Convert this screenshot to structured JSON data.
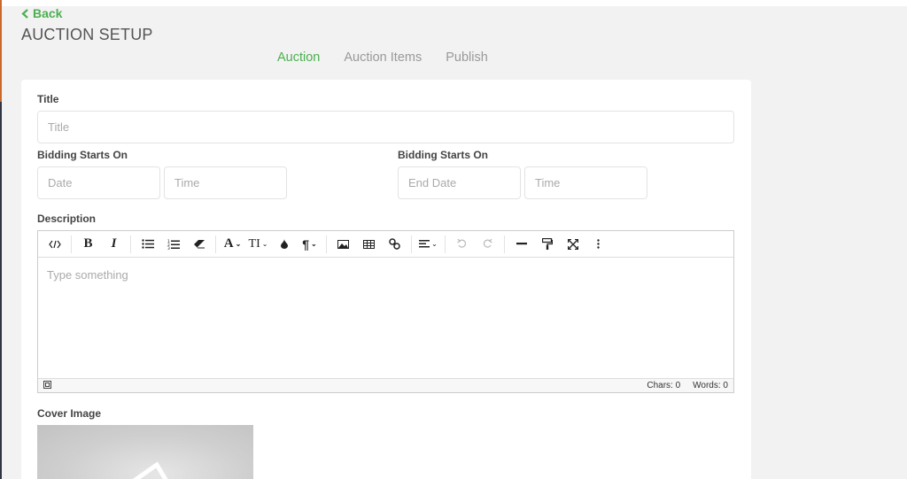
{
  "nav": {
    "back_label": "Back"
  },
  "header": {
    "title": "AUCTION SETUP"
  },
  "tabs": [
    {
      "label": "Auction",
      "active": true
    },
    {
      "label": "Auction Items",
      "active": false
    },
    {
      "label": "Publish",
      "active": false
    }
  ],
  "form": {
    "title_label": "Title",
    "title_placeholder": "Title",
    "start_label": "Bidding Starts On",
    "start_date_placeholder": "Date",
    "start_time_placeholder": "Time",
    "end_label": "Bidding Starts On",
    "end_date_placeholder": "End Date",
    "end_time_placeholder": "Time",
    "description_label": "Description",
    "editor_placeholder": "Type something",
    "chars_label": "Chars: 0",
    "words_label": "Words: 0",
    "cover_label": "Cover Image"
  },
  "toolbar_icons": [
    "code-view-icon",
    "bold-icon",
    "italic-icon",
    "unordered-list-icon",
    "ordered-list-icon",
    "clear-format-icon",
    "font-family-icon",
    "font-size-icon",
    "text-color-icon",
    "paragraph-format-icon",
    "insert-image-icon",
    "insert-table-icon",
    "insert-link-icon",
    "align-icon",
    "undo-icon",
    "redo-icon",
    "horizontal-rule-icon",
    "format-painter-icon",
    "fullscreen-icon",
    "more-icon"
  ],
  "colors": {
    "accent": "#4caf50",
    "tab_inactive": "#999999",
    "background": "#f2f2f2"
  }
}
